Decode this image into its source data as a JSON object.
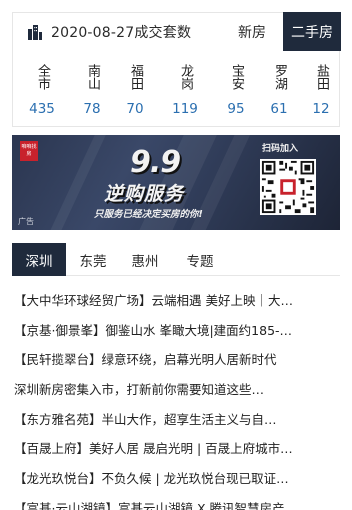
{
  "stats": {
    "title": "2020-08-27成交套数",
    "tabs": {
      "new_house": "新房",
      "second_hand": "二手房"
    },
    "districts": [
      {
        "name": "全市",
        "count": "435"
      },
      {
        "name": "南山",
        "count": "78"
      },
      {
        "name": "福田",
        "count": "70"
      },
      {
        "name": "龙岗",
        "count": "119"
      },
      {
        "name": "宝安",
        "count": "95"
      },
      {
        "name": "罗湖",
        "count": "61"
      },
      {
        "name": "盐田",
        "count": "12"
      }
    ]
  },
  "banner": {
    "logo_text": "咱咱找房",
    "headline": "9.9",
    "service": "逆购服务",
    "slogan": "只服务已经决定买房的你!",
    "scan_label": "扫码加入",
    "ad_label": "广告",
    "colors": {
      "background": "#2f3b57",
      "logo": "#c8222c"
    }
  },
  "news_tabs": [
    "深圳",
    "东莞",
    "惠州",
    "专题"
  ],
  "news": [
    "【大中华环球经贸广场】云端相遇 美好上映｜大…",
    "【京基·御景峯】御鉴山水 峯瞰大境|建面约185-…",
    "【民轩揽翠台】绿意环绕，启幕光明人居新时代",
    "深圳新房密集入市，打新前你需要知道这些…",
    "【东方雅名苑】半山大作，超享生活主义与自…",
    "【百晟上府】美好人居 晟启光明 | 百晟上府城市…",
    "【龙光玖悦台】不负久候 | 龙光玖悦台现已取证…",
    "【富基·云山湖镜】富基云山湖镜 X 腾讯智慧房产…"
  ],
  "colors": {
    "dark_navy": "#1f2a3c",
    "link_blue": "#2b6fb0",
    "border": "#e6e6e6"
  }
}
